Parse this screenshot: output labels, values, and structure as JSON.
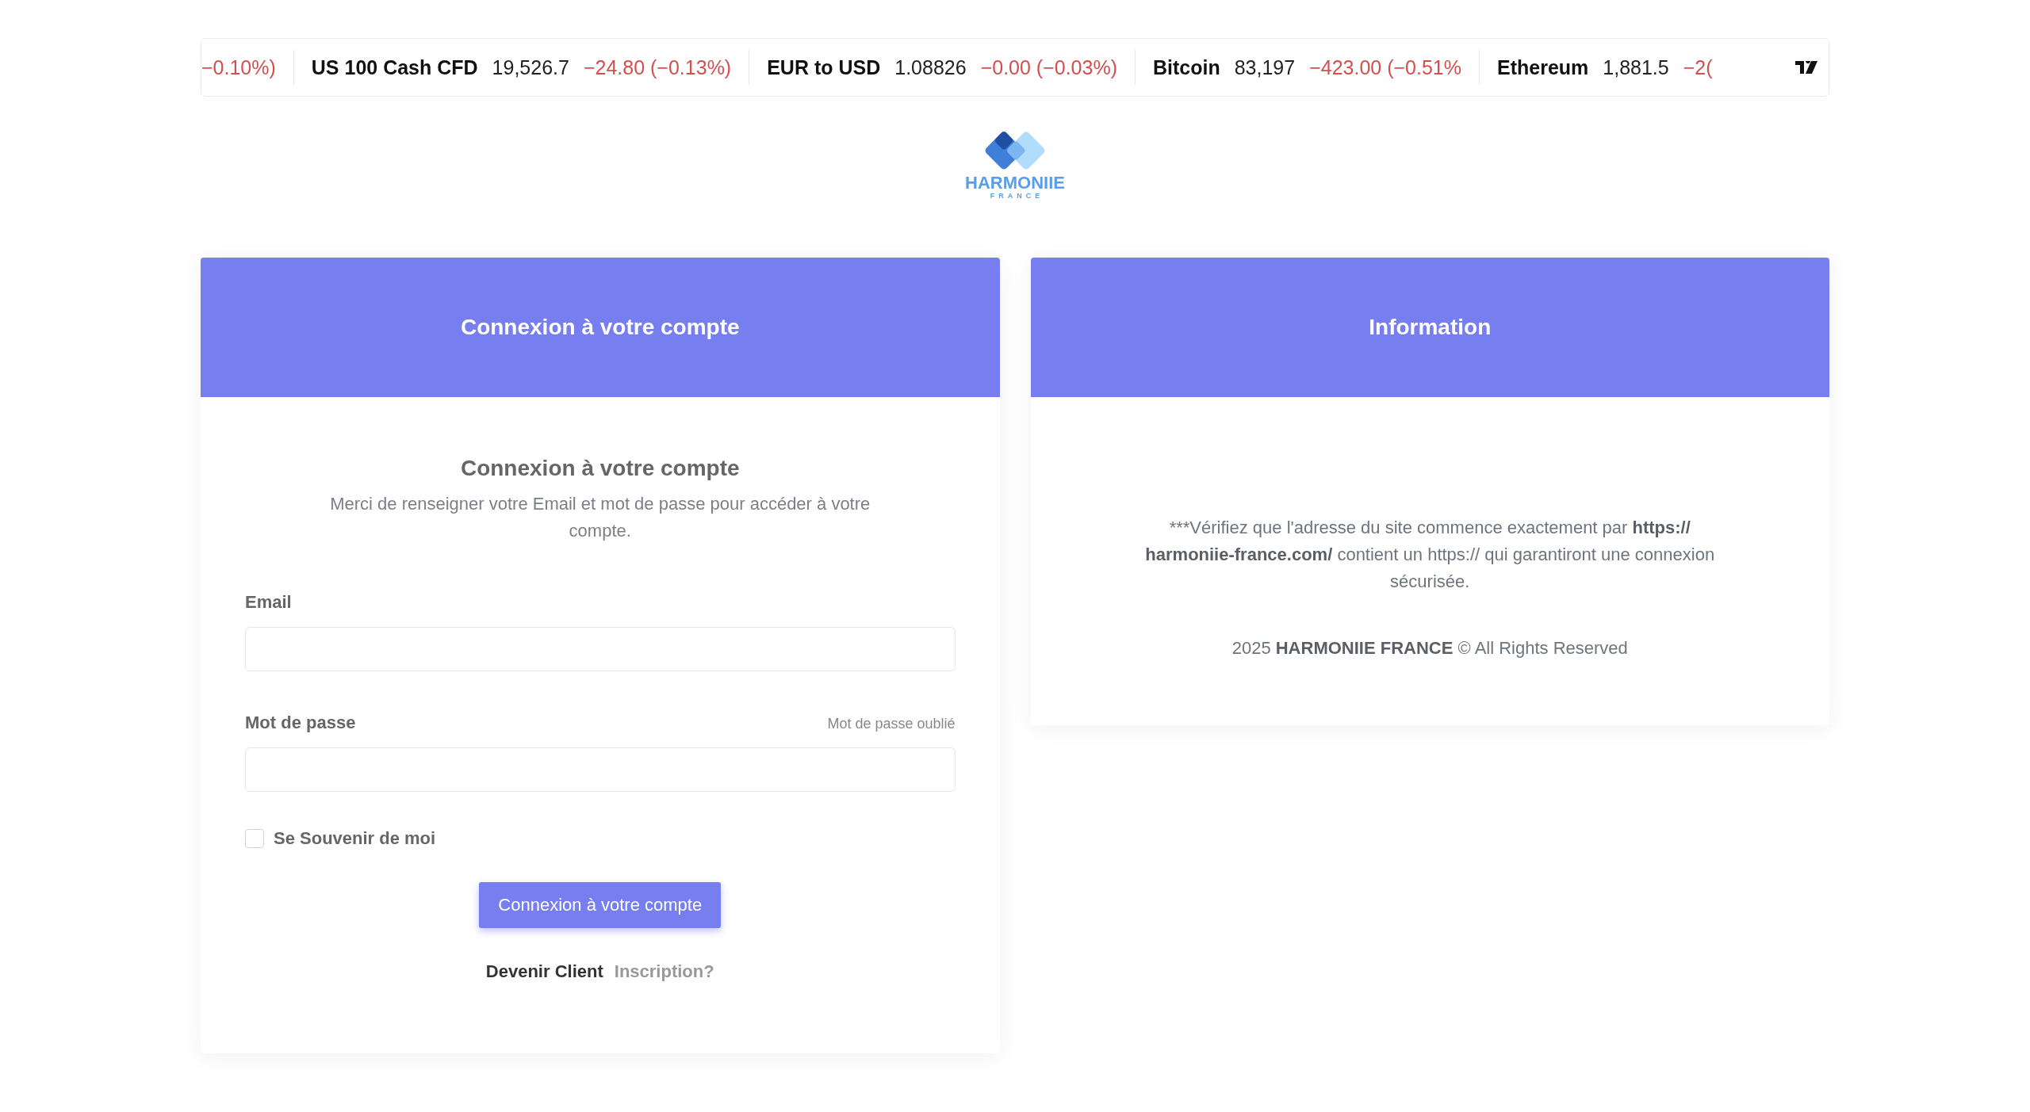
{
  "ticker": {
    "items": [
      {
        "change": "−0.10%)"
      },
      {
        "name": "US 100 Cash CFD",
        "price": "19,526.7",
        "change": "−24.80 (−0.13%)"
      },
      {
        "name": "EUR to USD",
        "price": "1.08826",
        "change": "−0.00 (−0.03%)"
      },
      {
        "name": "Bitcoin",
        "price": "83,197",
        "change": "−423.00 (−0.51%"
      },
      {
        "name": "Ethereum",
        "price": "1,881.5",
        "change": "−2("
      }
    ]
  },
  "logo": {
    "name": "HARMONIIE",
    "tagline": "FRANCE"
  },
  "login_card": {
    "header": "Connexion à votre compte",
    "title": "Connexion à votre compte",
    "subtitle": "Merci de renseigner votre Email et mot de passe pour accéder à votre compte.",
    "fields": [
      {
        "label": "Email"
      },
      {
        "label": "Mot de passe",
        "link": "Mot de passe oublié"
      }
    ],
    "remember": {
      "label": "Se Souvenir de moi",
      "checked": false
    },
    "submit": "Connexion à votre compte",
    "signup": {
      "text": "Devenir Client",
      "link": "Inscription?"
    }
  },
  "info_card": {
    "header": "Information",
    "notice": [
      {
        "text": "***Vérifiez que l'adresse du site commence exactement par ",
        "bold": false
      },
      {
        "text": "https:// harmoniie-france.com/",
        "bold": true
      },
      {
        "text": " contient un https:// qui garantiront une connexion sécurisée.",
        "bold": false
      }
    ],
    "copyright": "2025 **HARMONIIE FRANCE** © All Rights Reserved"
  }
}
